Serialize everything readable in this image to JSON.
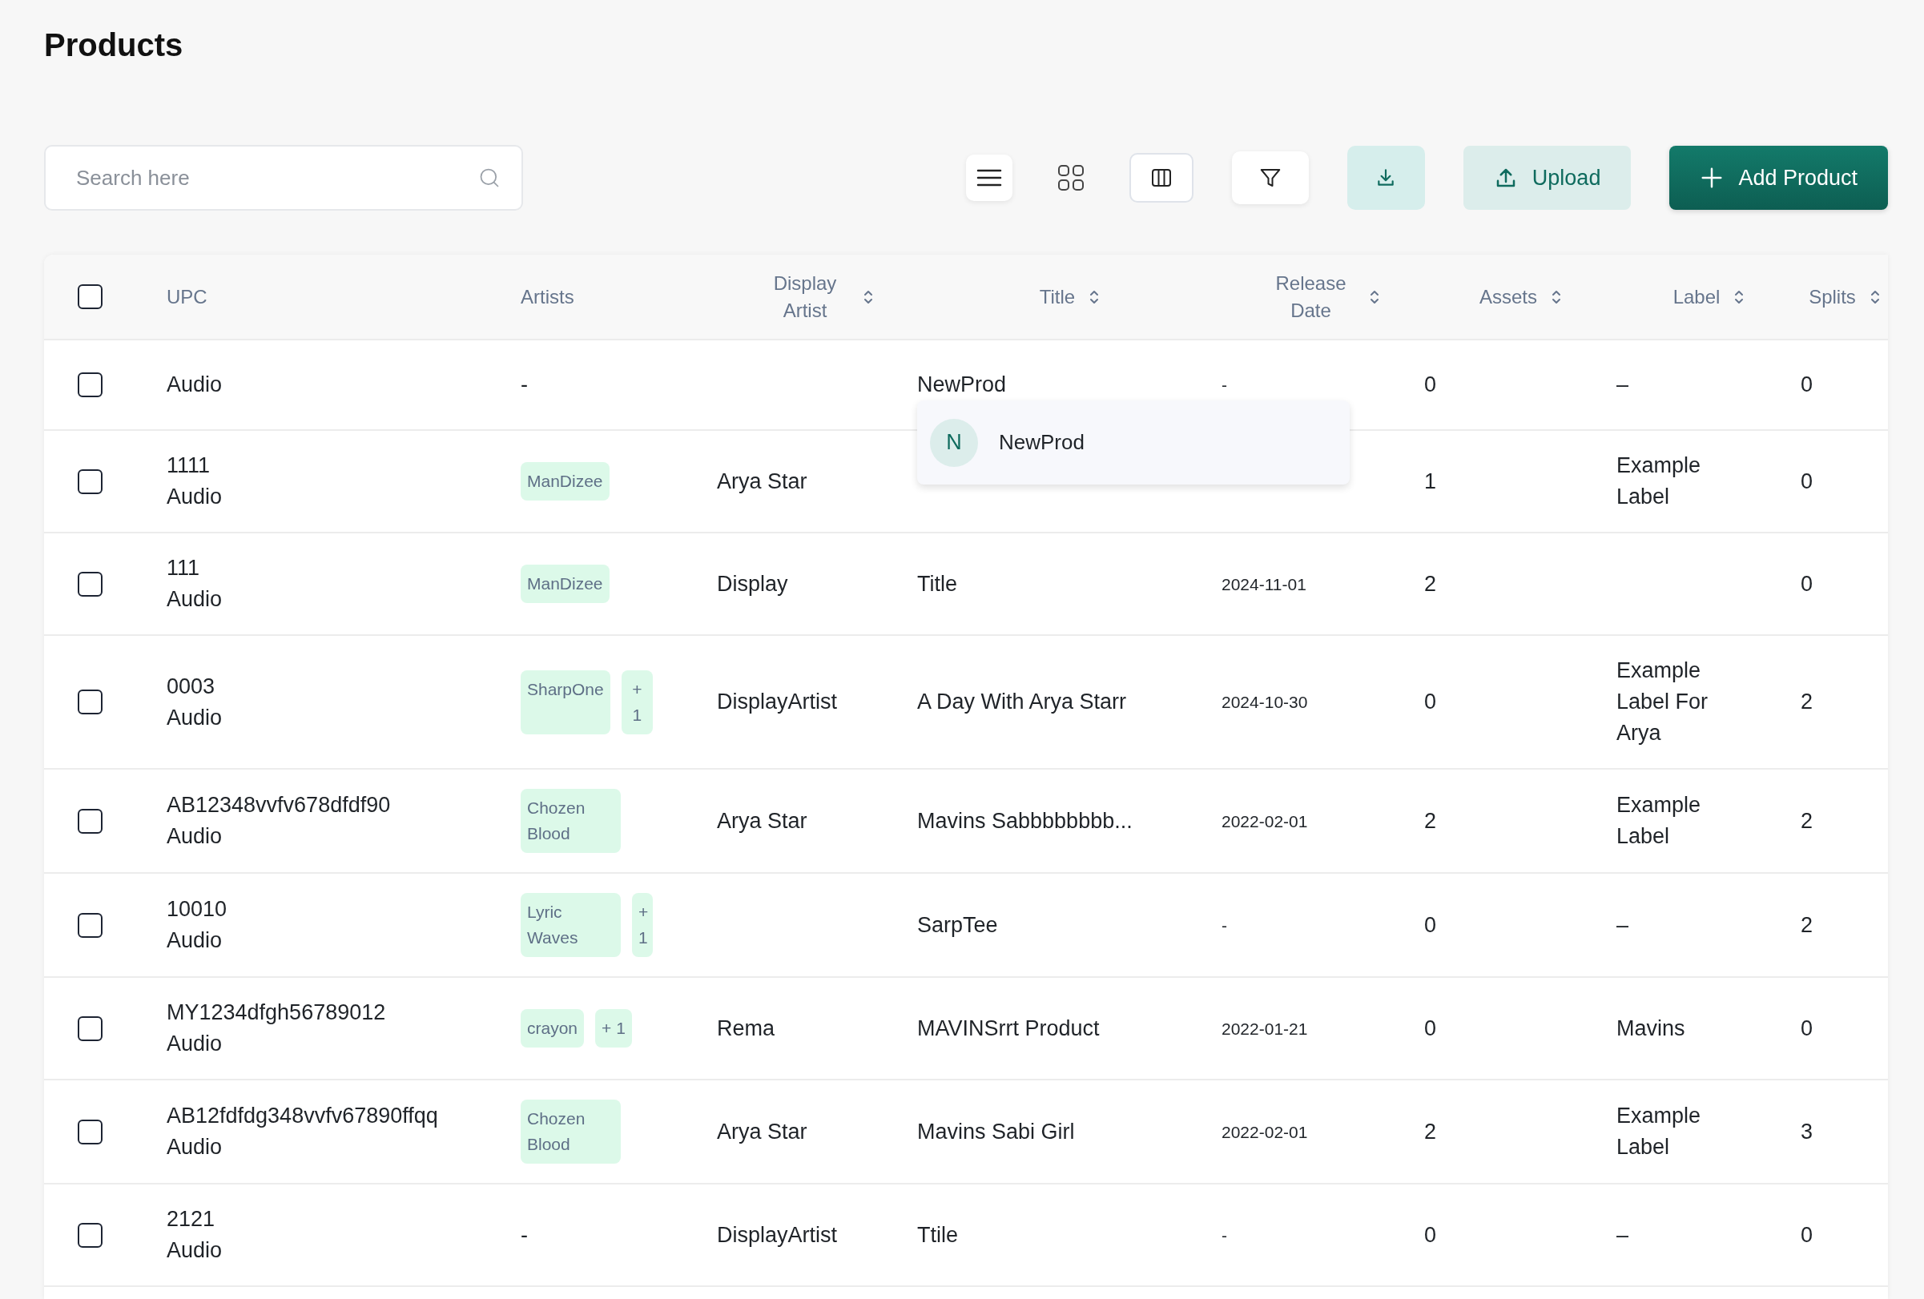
{
  "page": {
    "title": "Products"
  },
  "search": {
    "placeholder": "Search here"
  },
  "actions": {
    "upload": "Upload",
    "add": "Add Product"
  },
  "table": {
    "select_all": {
      "checked": false
    },
    "columns": [
      {
        "label": "UPC",
        "sortable": false
      },
      {
        "label": "Artists",
        "sortable": false
      },
      {
        "label": "Display Artist",
        "sortable": true
      },
      {
        "label": "Title",
        "sortable": true
      },
      {
        "label": "Release Date",
        "sortable": true
      },
      {
        "label": "Assets",
        "sortable": true
      },
      {
        "label": "Label",
        "sortable": true
      },
      {
        "label": "Splits",
        "sortable": true
      }
    ],
    "rows": [
      {
        "checked": false,
        "type": "Audio",
        "artists_text": "-",
        "title": "NewProd",
        "release_date": "-",
        "assets": "0",
        "label": "–",
        "splits": "0"
      },
      {
        "checked": false,
        "upc": "1111",
        "type": "Audio",
        "artists": [
          "ManDizee"
        ],
        "display_artist": "Arya Star",
        "assets": "1",
        "label": "Example Label",
        "splits": "0"
      },
      {
        "checked": false,
        "upc": "111",
        "type": "Audio",
        "artists": [
          "ManDizee"
        ],
        "display_artist": "Display",
        "title": "Title",
        "release_date": "2024-11-01",
        "assets": "2",
        "splits": "0"
      },
      {
        "checked": false,
        "upc": "0003",
        "type": "Audio",
        "artists": [
          "SharpOne"
        ],
        "more": "+ 1",
        "display_artist": "DisplayArtist",
        "title": "A Day With Arya Starr",
        "release_date": "2024-10-30",
        "assets": "0",
        "label": "Example Label For Arya",
        "splits": "2"
      },
      {
        "checked": false,
        "upc": "AB12348vvfv678dfdf90",
        "type": "Audio",
        "artists": [
          "Chozen Blood"
        ],
        "display_artist": "Arya Star",
        "title": "Mavins Sabbbbbbbb...",
        "release_date": "2022-02-01",
        "assets": "2",
        "label": "Example Label",
        "splits": "2"
      },
      {
        "checked": false,
        "upc": "10010",
        "type": "Audio",
        "artists": [
          "Lyric Waves"
        ],
        "more": "+ 1",
        "title": "SarpTee",
        "release_date": "-",
        "assets": "0",
        "label": "–",
        "splits": "2"
      },
      {
        "checked": false,
        "upc": "MY1234dfgh56789012",
        "type": "Audio",
        "artists": [
          "crayon"
        ],
        "more": "+ 1",
        "display_artist": "Rema",
        "title": "MAVINSrrt Product",
        "release_date": "2022-01-21",
        "assets": "0",
        "label": "Mavins",
        "splits": "0"
      },
      {
        "checked": false,
        "upc": "AB12fdfdg348vvfv67890ffqq",
        "type": "Audio",
        "artists": [
          "Chozen Blood"
        ],
        "display_artist": "Arya Star",
        "title": "Mavins Sabi Girl",
        "release_date": "2022-02-01",
        "assets": "2",
        "label": "Example Label",
        "splits": "3"
      },
      {
        "checked": false,
        "upc": "2121",
        "type": "Audio",
        "artists_text": "-",
        "display_artist": "DisplayArtist",
        "title": "Ttile",
        "release_date": "-",
        "assets": "0",
        "label": "–",
        "splits": "0"
      }
    ]
  },
  "popup": {
    "initial": "N",
    "text": "NewProd"
  }
}
